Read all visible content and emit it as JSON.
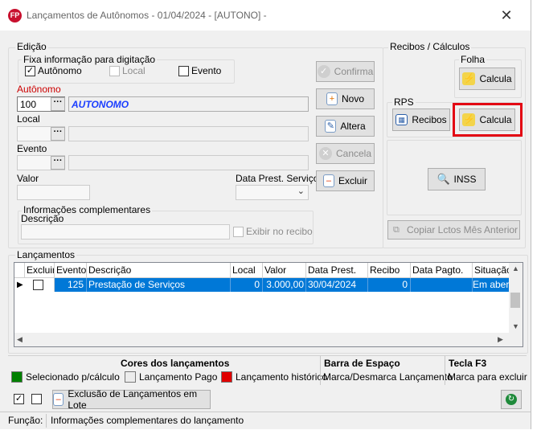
{
  "window": {
    "logo": "FP",
    "title": "Lançamentos de Autônomos -  01/04/2024 - [AUTONO] -",
    "close": "✕"
  },
  "edicao": {
    "group_label": "Edição",
    "fixa_label": "Fixa informação para digitação",
    "fixa_autonomo": "Autônomo",
    "fixa_local": "Local",
    "fixa_evento": "Evento",
    "autonomo_label": "Autônomo",
    "autonomo_code": "100",
    "autonomo_name": "AUTONOMO",
    "local_label": "Local",
    "evento_label": "Evento",
    "valor_label": "Valor",
    "data_prest_label": "Data Prest. Serviço",
    "ellipsis": "···",
    "info_group_label": "Informações complementares",
    "descricao_label": "Descrição",
    "exibir_label": "Exibir no recibo"
  },
  "actions": {
    "confirma": "Confirma",
    "novo": "Novo",
    "altera": "Altera",
    "cancela": "Cancela",
    "excluir": "Excluir"
  },
  "recibos": {
    "group_label": "Recibos / Cálculos",
    "folha_label": "Folha",
    "folha_calcula": "Calcula",
    "rps_label": "RPS",
    "rps_recibos": "Recibos",
    "rps_calcula": "Calcula",
    "inss": "INSS",
    "copiar": "Copiar Lctos Mês Anterior"
  },
  "lancamentos": {
    "group_label": "Lançamentos",
    "columns": [
      "Excluir",
      "Evento",
      "Descrição",
      "Local",
      "Valor",
      "Data Prest.",
      "Recibo",
      "Data Pagto.",
      "Situação"
    ],
    "rows": [
      {
        "evento": "125",
        "descricao": "Prestação de Serviços",
        "local": "0",
        "valor": "3.000,00",
        "data_prest": "30/04/2024",
        "recibo": "0",
        "data_pagto": "",
        "situacao": "Em aber"
      }
    ]
  },
  "legend": {
    "cores_title": "Cores dos lançamentos",
    "selecionado": "Selecionado p/cálculo",
    "pago": "Lançamento Pago",
    "historico": "Lançamento histórico",
    "barra_title": "Barra de Espaço",
    "barra_desc": "Marca/Desmarca Lançamento",
    "tecla_title": "Tecla F3",
    "tecla_desc": "Marca para excluir",
    "colors": {
      "selecionado": "#008000",
      "pago": "#ececec",
      "historico": "#e00000"
    }
  },
  "bottom": {
    "exclusao_lote": "Exclusão de Lançamentos em Lote"
  },
  "status": {
    "label": "Função:",
    "text": "Informações complementares do lançamento"
  }
}
